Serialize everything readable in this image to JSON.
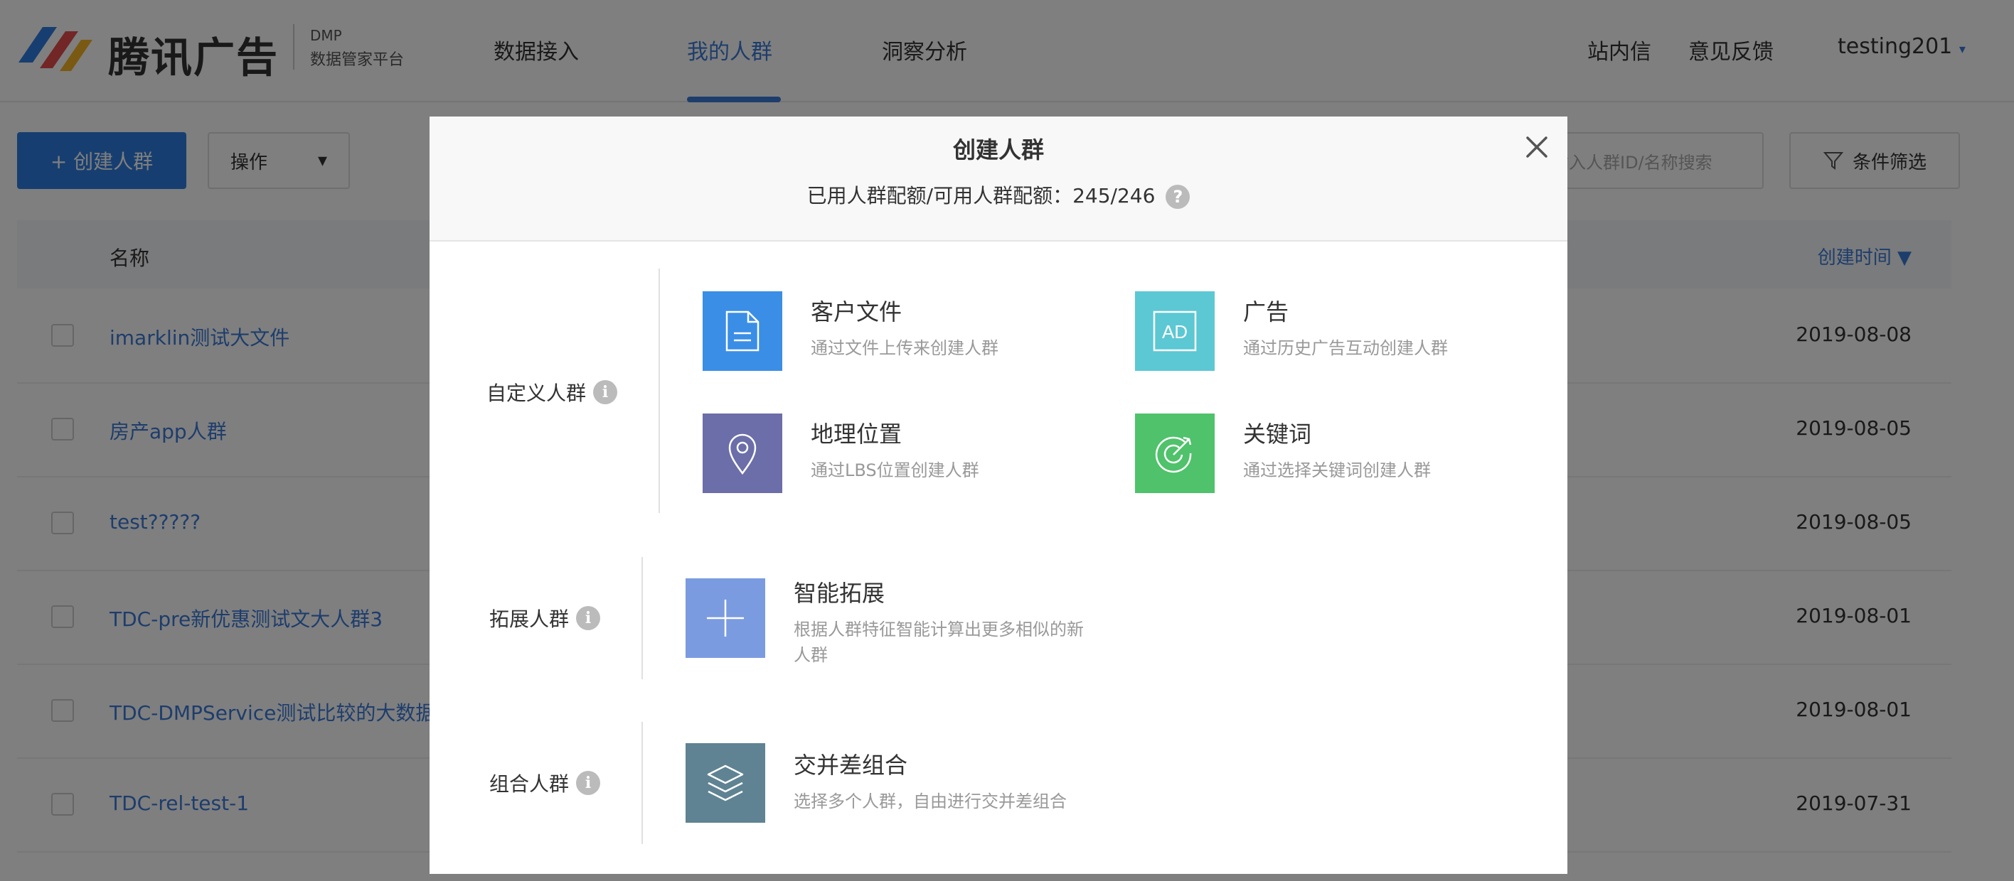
{
  "header": {
    "logo_text": "腾讯广告",
    "logo_sub1": "DMP",
    "logo_sub2": "数据管家平台",
    "nav": [
      {
        "label": "数据接入"
      },
      {
        "label": "我的人群"
      },
      {
        "label": "洞察分析"
      }
    ],
    "right_links": [
      {
        "label": "站内信"
      },
      {
        "label": "意见反馈"
      }
    ],
    "user": "testing201",
    "user_caret": "▾"
  },
  "toolbar": {
    "create_label": "+ 创建人群",
    "operation_label": "操作",
    "operation_caret": "▾",
    "search_placeholder": "输入人群ID/名称搜索",
    "filter_label": "条件筛选"
  },
  "table": {
    "col_name": "名称",
    "col_time": "创建时间 ▼",
    "rows": [
      {
        "name": "imarklin测试大文件",
        "date": "2019-08-08"
      },
      {
        "name": "房产app人群",
        "date": "2019-08-05"
      },
      {
        "name": "test?????",
        "date": "2019-08-05"
      },
      {
        "name": "TDC-pre新优惠测试文大人群3",
        "date": "2019-08-01"
      },
      {
        "name": "TDC-DMPService测试比较的大数据",
        "date": "2019-08-01"
      },
      {
        "name": "TDC-rel-test-1",
        "date": "2019-07-31"
      }
    ]
  },
  "modal": {
    "title": "创建人群",
    "quota_label": "已用人群配额/可用人群配额：",
    "quota_value": "245/246",
    "help_glyph": "?",
    "info_glyph": "i",
    "sections": {
      "custom": {
        "label": "自定义人群",
        "cards": [
          {
            "title": "客户文件",
            "desc": "通过文件上传来创建人群",
            "color": "#3a8ee6",
            "icon": "file-icon"
          },
          {
            "title": "广告",
            "desc": "通过历史广告互动创建人群",
            "color": "#5bc8d4",
            "icon": "ad-icon",
            "icon_text": "AD"
          },
          {
            "title": "地理位置",
            "desc": "通过LBS位置创建人群",
            "color": "#6b6ea8",
            "icon": "location-icon"
          },
          {
            "title": "关键词",
            "desc": "通过选择关键词创建人群",
            "color": "#4fc26b",
            "icon": "target-icon"
          }
        ]
      },
      "expand": {
        "label": "拓展人群",
        "cards": [
          {
            "title": "智能拓展",
            "desc": "根据人群特征智能计算出更多相似的新人群",
            "color": "#7b9be0",
            "icon": "plus-icon"
          }
        ]
      },
      "combine": {
        "label": "组合人群",
        "cards": [
          {
            "title": "交并差组合",
            "desc": "选择多个人群，自由进行交并差组合",
            "color": "#5f8393",
            "icon": "layers-icon"
          }
        ]
      }
    }
  }
}
